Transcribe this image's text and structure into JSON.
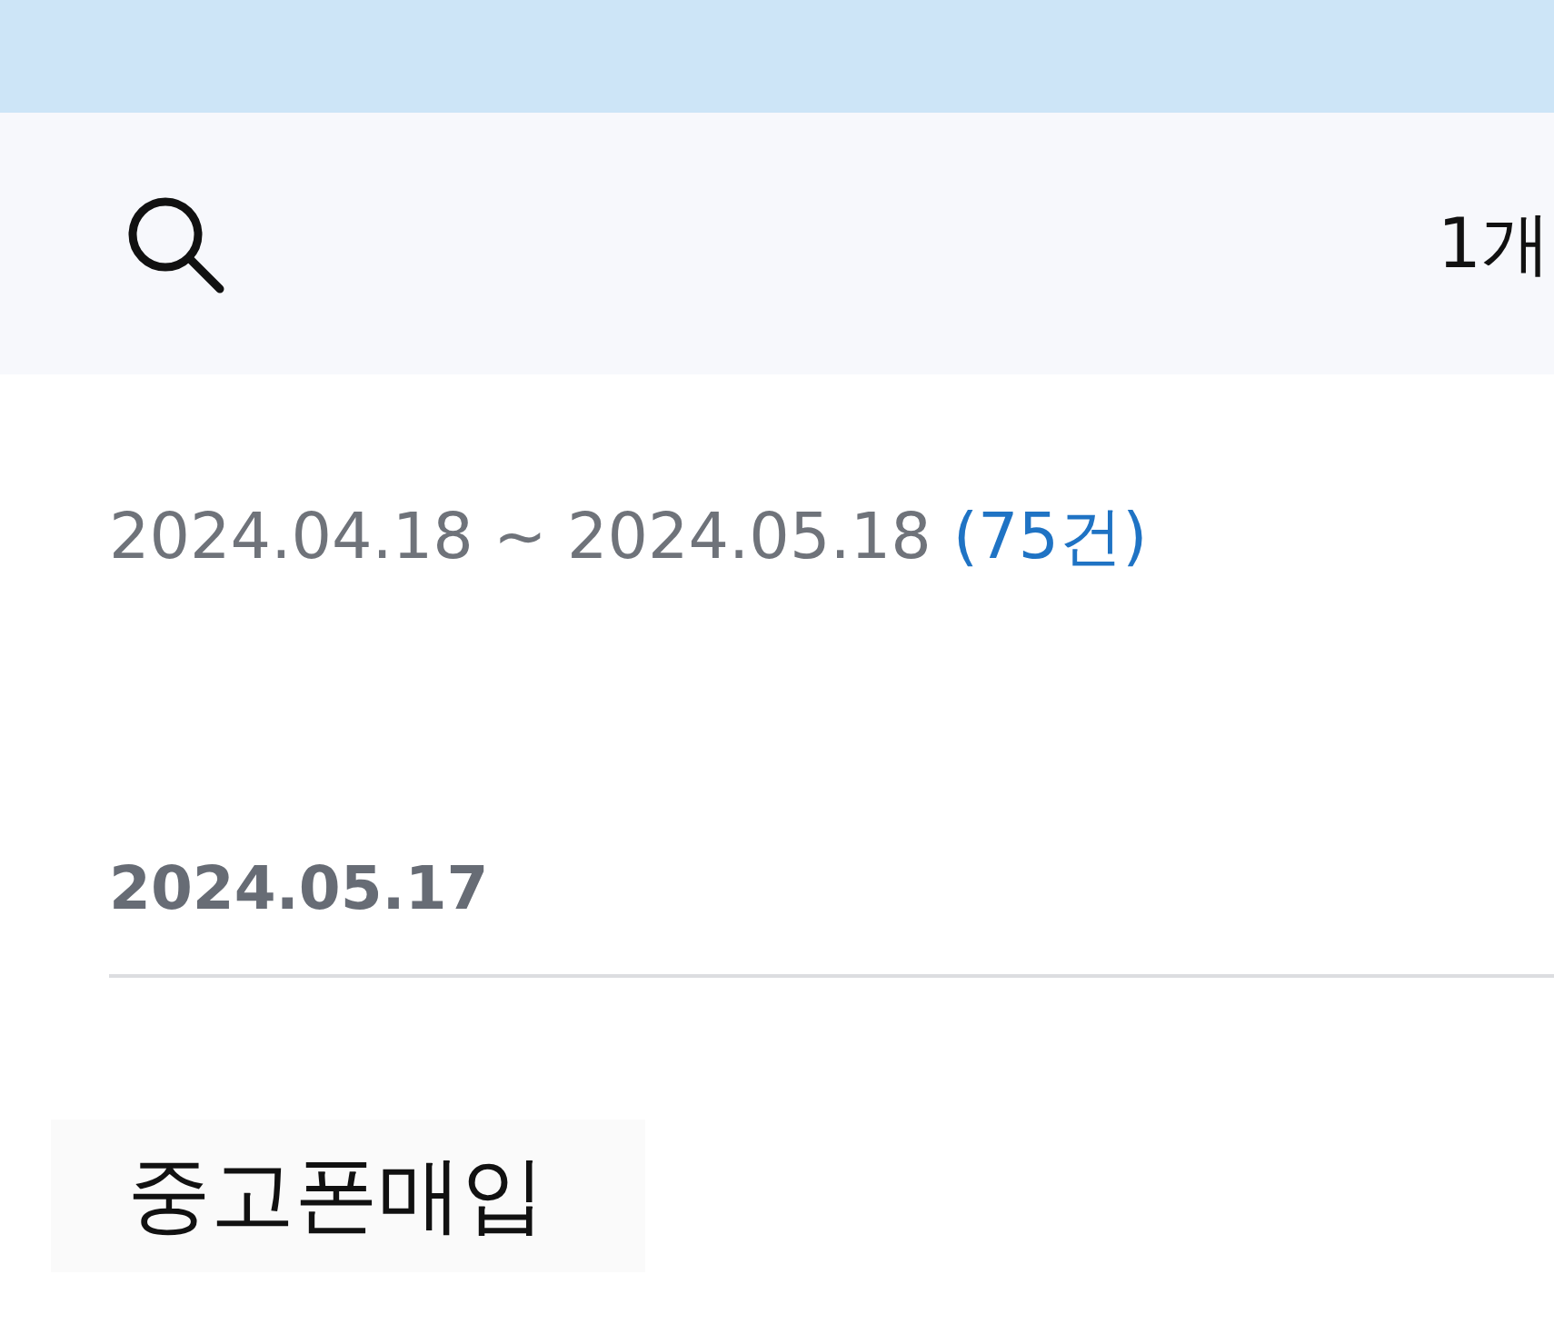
{
  "filter_bar": {
    "period": "1개"
  },
  "range": {
    "dates": "2024.04.18 ~ 2024.05.18",
    "count": "(75건)"
  },
  "groups": [
    {
      "date": "2024.05.17",
      "items": [
        {
          "title": "중고폰매입"
        }
      ]
    }
  ]
}
